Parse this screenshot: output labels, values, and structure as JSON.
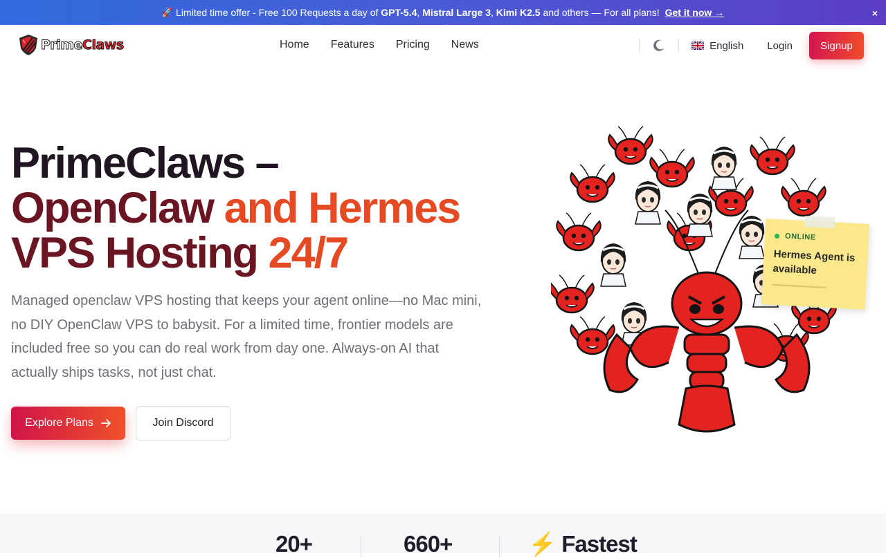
{
  "promo": {
    "prefix": "Limited time offer - Free 100 Requests a day of ",
    "model1": "GPT-5.4",
    "sep1": ", ",
    "model2": "Mistral Large 3",
    "sep2": ", ",
    "model3": "Kimi K2.5",
    "suffix": " and others — For all plans!",
    "cta": "Get it now →",
    "close": "×"
  },
  "nav": {
    "brand_part1": "Prime",
    "brand_part2": "Claws",
    "links": [
      "Home",
      "Features",
      "Pricing",
      "News"
    ],
    "language": "English",
    "login": "Login",
    "signup": "Signup"
  },
  "hero": {
    "title_l1a": "PrimeClaws –",
    "title_l2a": "OpenClaw",
    "title_l2b": " and Hermes",
    "title_l3a": "VPS Hosting",
    "title_l3b": " 24/7",
    "description": "Managed openclaw VPS hosting that keeps your agent online—no Mac mini, no DIY OpenClaw VPS to babysit. For a limited time, frontier models are included free so you can do real work from day one. Always-on AI that actually ships tasks, not just chat.",
    "explore_button": "Explore Plans",
    "discord_button": "Join Discord"
  },
  "note": {
    "status": "ONLINE",
    "message": "Hermes Agent is available"
  },
  "stats": {
    "items": [
      "20+",
      "660+",
      "⚡ Fastest"
    ]
  },
  "colors": {
    "accent_red": "#d4164f",
    "accent_orange": "#ef4b2a",
    "banner_blue": "#2f6bdc",
    "banner_purple": "#5b3cc4"
  },
  "icons": [
    "rocket-icon",
    "close-icon",
    "moon-icon",
    "uk-flag-icon",
    "arrow-right-icon",
    "lightning-icon"
  ]
}
